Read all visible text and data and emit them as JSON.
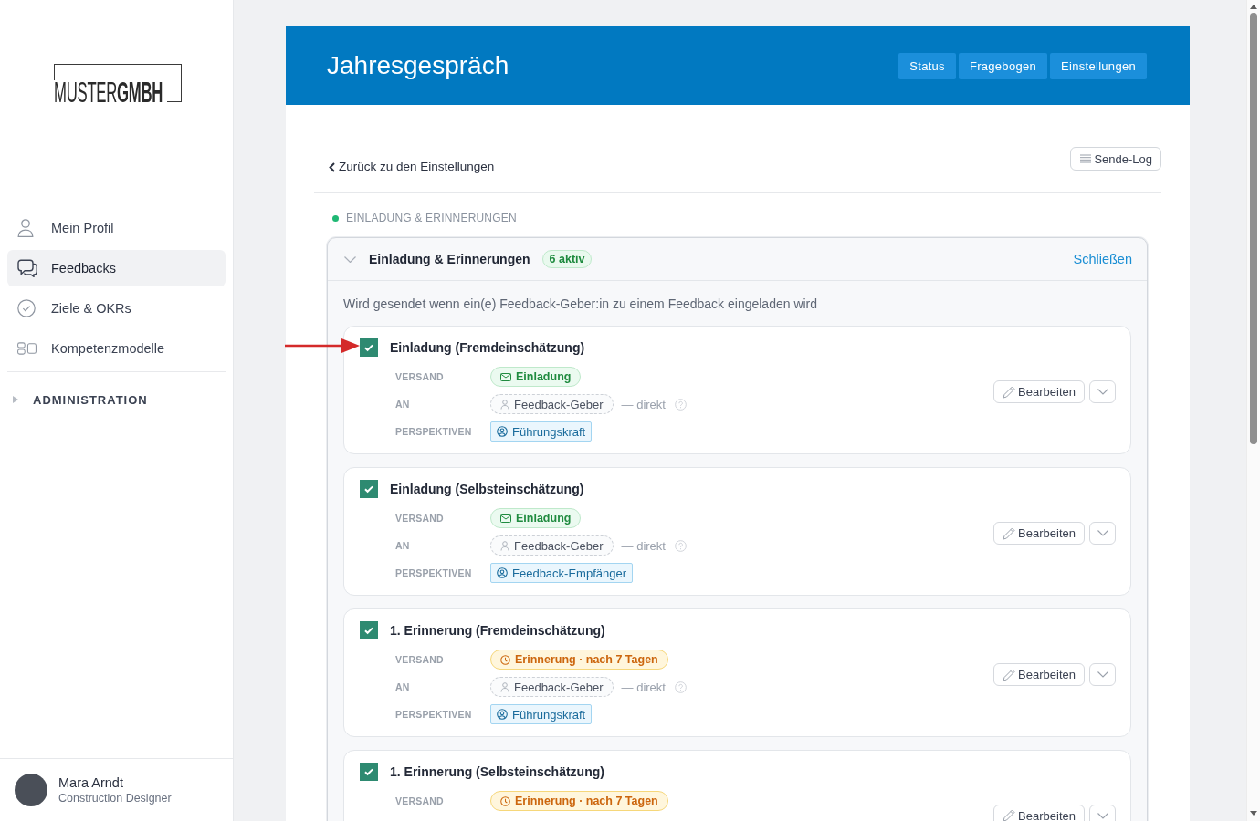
{
  "sidebar": {
    "logo": "MUSTER**GMBH**",
    "items": [
      {
        "label": "Mein Profil",
        "selected": false
      },
      {
        "label": "Feedbacks",
        "selected": true
      },
      {
        "label": "Ziele & OKRs",
        "selected": false
      },
      {
        "label": "Kompetenzmodelle",
        "selected": false
      }
    ],
    "section": {
      "label": "ADMINISTRATION",
      "expanded": false
    },
    "user": {
      "name": "Mara Arndt",
      "role": "Construction Designer"
    }
  },
  "header": {
    "title": "Jahresgespräch",
    "buttons": [
      "Status",
      "Fragebogen",
      "Einstellungen"
    ]
  },
  "toolbar": {
    "back_link": "Zurück zu den Einstellungen",
    "log_button": "Sende-Log"
  },
  "section_label": "EINLADUNG & ERINNERUNGEN",
  "panel": {
    "title": "Einladung & Erinnerungen",
    "badge": "6 aktiv",
    "expanded": true,
    "close_link": "Schließen",
    "description": "Wird gesendet wenn ein(e) Feedback-Geber:in zu einem Feedback eingeladen wird",
    "items": [
      {
        "title": "Einladung (Fremdeinschätzung)",
        "checked": true,
        "rows": [
          {
            "kind": "invitation",
            "label": "VERSAND",
            "value": "Einladung"
          },
          {
            "kind": "recipient",
            "label": "AN",
            "value": "Feedback-Geber",
            "note": "— direkt"
          },
          {
            "kind": "perspective",
            "label": "PERSPEKTIVEN",
            "value": "Führungskraft"
          }
        ],
        "edit_button": "Bearbeiten"
      },
      {
        "title": "Einladung (Selbsteinschätzung)",
        "checked": true,
        "rows": [
          {
            "kind": "invitation",
            "label": "VERSAND",
            "value": "Einladung"
          },
          {
            "kind": "recipient",
            "label": "AN",
            "value": "Feedback-Geber",
            "note": "— direkt"
          },
          {
            "kind": "perspective",
            "label": "PERSPEKTIVEN",
            "value": "Feedback-Empfänger"
          }
        ],
        "edit_button": "Bearbeiten"
      },
      {
        "title": "1. Erinnerung (Fremdeinschätzung)",
        "checked": true,
        "rows": [
          {
            "kind": "reminder",
            "label": "VERSAND",
            "value": "Erinnerung · nach 7 Tagen"
          },
          {
            "kind": "recipient",
            "label": "AN",
            "value": "Feedback-Geber",
            "note": "— direkt"
          },
          {
            "kind": "perspective",
            "label": "PERSPEKTIVEN",
            "value": "Führungskraft"
          }
        ],
        "edit_button": "Bearbeiten"
      },
      {
        "title": "1. Erinnerung (Selbsteinschätzung)",
        "checked": true,
        "rows": [
          {
            "kind": "reminder",
            "label": "VERSAND",
            "value": "Erinnerung · nach 7 Tagen"
          }
        ],
        "edit_button": "Bearbeiten"
      }
    ]
  }
}
